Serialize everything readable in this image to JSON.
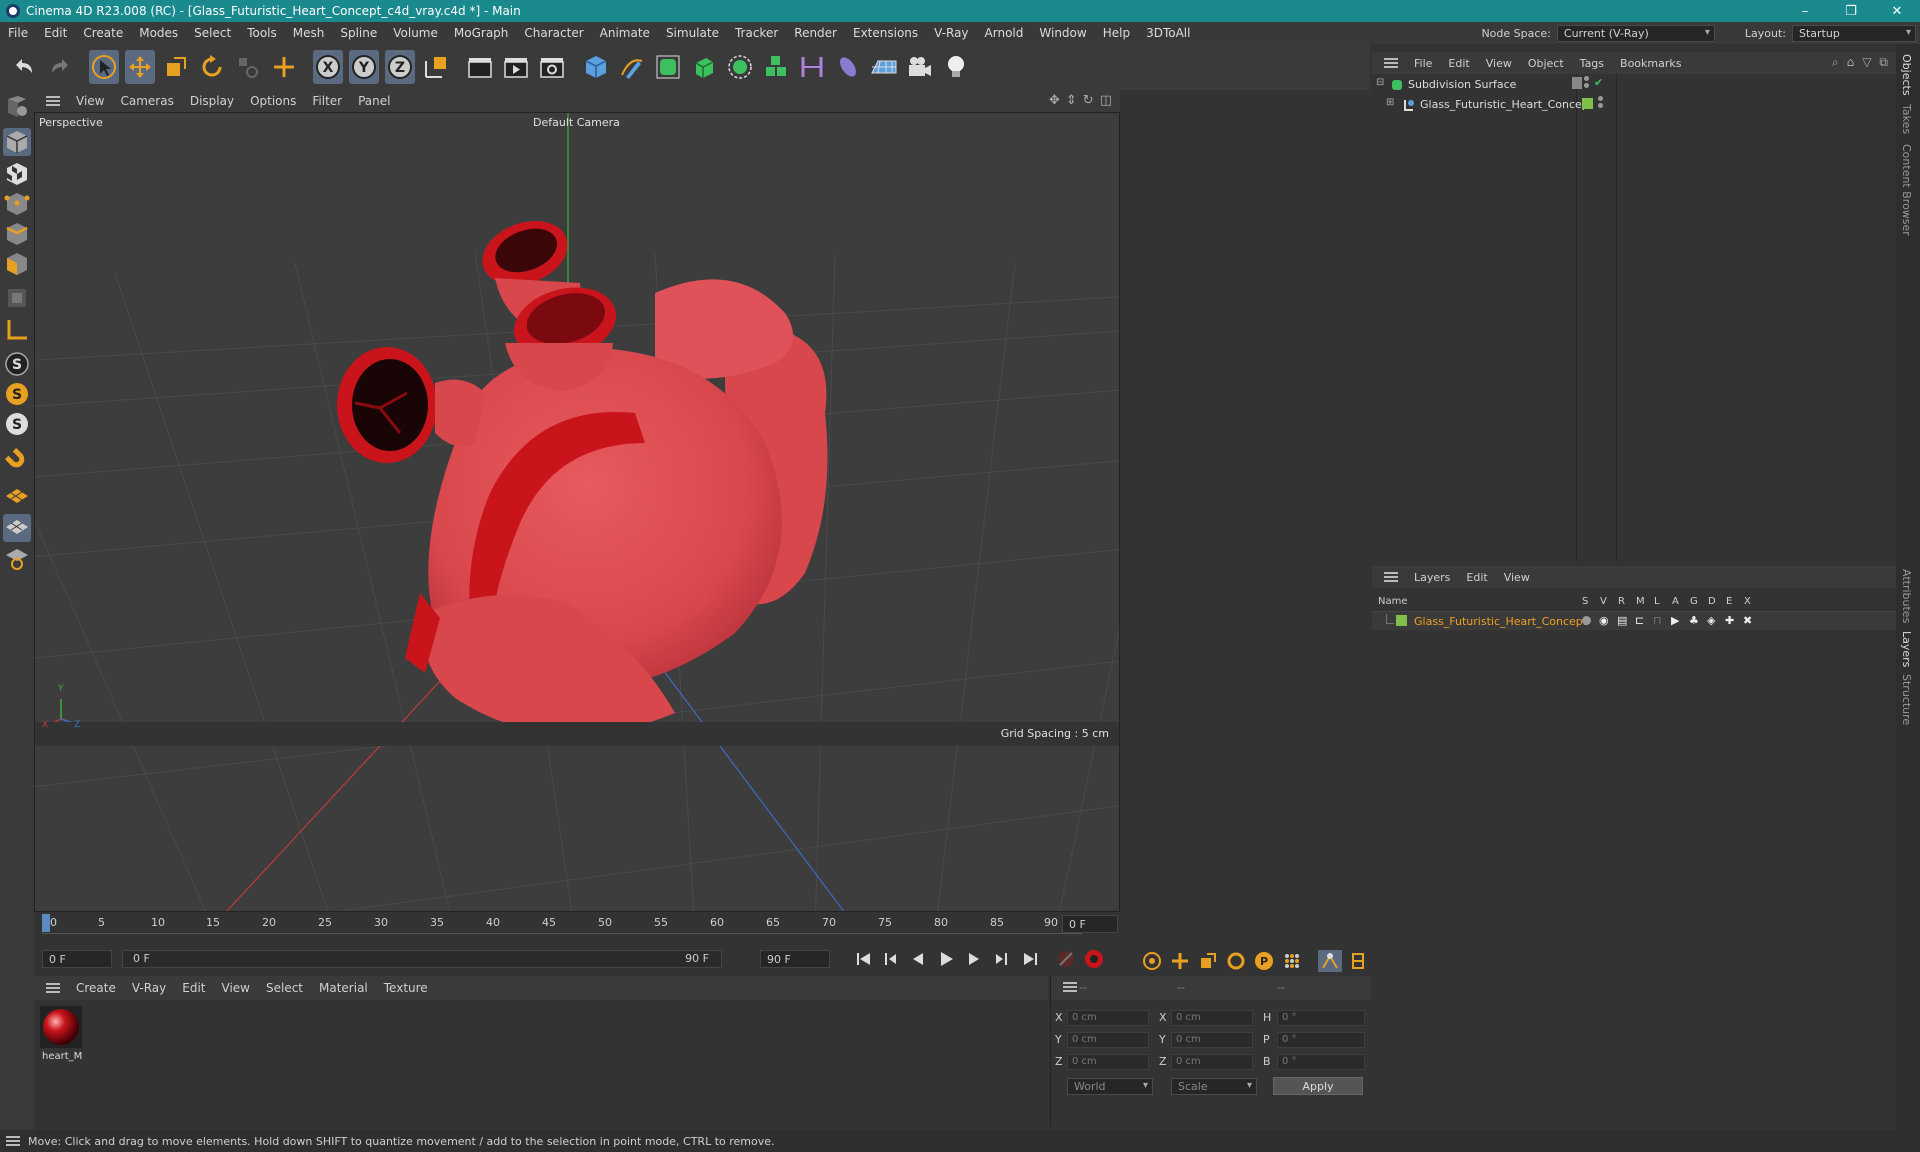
{
  "window": {
    "title": "Cinema 4D R23.008 (RC) - [Glass_Futuristic_Heart_Concept_c4d_vray.c4d *] - Main",
    "minimize": "–",
    "maximize": "❐",
    "close": "✕"
  },
  "menu": [
    "File",
    "Edit",
    "Create",
    "Modes",
    "Select",
    "Tools",
    "Mesh",
    "Spline",
    "Volume",
    "MoGraph",
    "Character",
    "Animate",
    "Simulate",
    "Tracker",
    "Render",
    "Extensions",
    "V-Ray",
    "Arnold",
    "Window",
    "Help",
    "3DToAll"
  ],
  "node_space": {
    "label": "Node Space:",
    "value": "Current (V-Ray)"
  },
  "layout": {
    "label": "Layout:",
    "value": "Startup"
  },
  "viewport": {
    "menu": [
      "View",
      "Cameras",
      "Display",
      "Options",
      "Filter",
      "Panel"
    ],
    "name": "Perspective",
    "camera": "Default Camera",
    "grid_spacing": "Grid Spacing : 5 cm",
    "axis_y": "Y",
    "axis_x": "X",
    "axis_z": "Z"
  },
  "timeline": {
    "ticks": [
      "0",
      "5",
      "10",
      "15",
      "20",
      "25",
      "30",
      "35",
      "40",
      "45",
      "50",
      "55",
      "60",
      "65",
      "70",
      "75",
      "80",
      "85",
      "90"
    ],
    "current_frame": "0 F",
    "start_field": "0 F",
    "range_start": "0 F",
    "range_end": "90 F",
    "end_field": "90 F"
  },
  "material_manager": {
    "menu": [
      "Create",
      "V-Ray",
      "Edit",
      "View",
      "Select",
      "Material",
      "Texture"
    ],
    "materials": [
      {
        "name": "heart_M"
      }
    ]
  },
  "coordinates": {
    "headers": [
      "--",
      "--",
      "--"
    ],
    "rows": [
      {
        "a": "X",
        "av": "0 cm",
        "b": "X",
        "bv": "0 cm",
        "c": "H",
        "cv": "0 °"
      },
      {
        "a": "Y",
        "av": "0 cm",
        "b": "Y",
        "bv": "0 cm",
        "c": "P",
        "cv": "0 °"
      },
      {
        "a": "Z",
        "av": "0 cm",
        "b": "Z",
        "bv": "0 cm",
        "c": "B",
        "cv": "0 °"
      }
    ],
    "mode": "World",
    "transform": "Scale",
    "apply": "Apply"
  },
  "object_manager": {
    "menu": [
      "File",
      "Edit",
      "View",
      "Object",
      "Tags",
      "Bookmarks"
    ],
    "objects": [
      {
        "name": "Subdivision Surface",
        "level": 0
      },
      {
        "name": "Glass_Futuristic_Heart_Concept",
        "level": 1
      }
    ]
  },
  "layer_manager": {
    "menu": [
      "Layers",
      "Edit",
      "View"
    ],
    "columns": [
      "Name",
      "S",
      "V",
      "R",
      "M",
      "L",
      "A",
      "G",
      "D",
      "E",
      "X"
    ],
    "layers": [
      {
        "name": "Glass_Futuristic_Heart_Concept",
        "color": "#7fc04a"
      }
    ]
  },
  "side_tabs": [
    "Objects",
    "Takes",
    "Content Browser",
    "Attributes",
    "Layers",
    "Structure"
  ],
  "status": "Move: Click and drag to move elements. Hold down SHIFT to quantize movement / add to the selection in point mode, CTRL to remove.",
  "colors": {
    "accent": "#1a8a8f",
    "heart": "#d8474c",
    "heart_dark": "#c8141a",
    "layer_text": "#f0a020"
  }
}
